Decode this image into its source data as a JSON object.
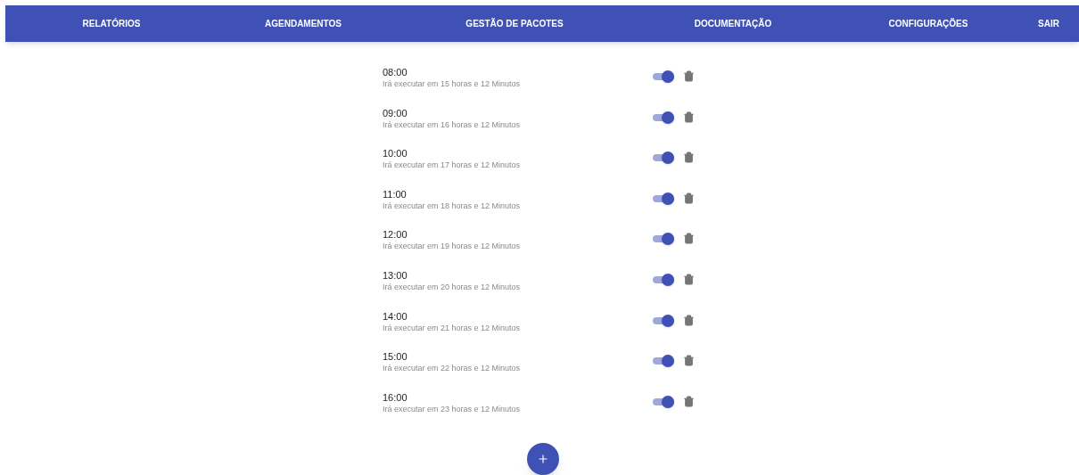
{
  "nav": [
    {
      "label": "RELATÓRIOS"
    },
    {
      "label": "AGENDAMENTOS"
    },
    {
      "label": "GESTÃO DE PACOTES"
    },
    {
      "label": "DOCUMENTAÇÃO"
    },
    {
      "label": "CONFIGURAÇÕES"
    },
    {
      "label": "SAIR"
    }
  ],
  "schedules": [
    {
      "time": "08:00",
      "subtitle": "Irá executar em 15 horas e 12 Minutos",
      "on": true
    },
    {
      "time": "09:00",
      "subtitle": "Irá executar em 16 horas e 12 Minutos",
      "on": true
    },
    {
      "time": "10:00",
      "subtitle": "Irá executar em 17 horas e 12 Minutos",
      "on": true
    },
    {
      "time": "11:00",
      "subtitle": "Irá executar em 18 horas e 12 Minutos",
      "on": true
    },
    {
      "time": "12:00",
      "subtitle": "Irá executar em 19 horas e 12 Minutos",
      "on": true
    },
    {
      "time": "13:00",
      "subtitle": "Irá executar em 20 horas e 12 Minutos",
      "on": true
    },
    {
      "time": "14:00",
      "subtitle": "Irá executar em 21 horas e 12 Minutos",
      "on": true
    },
    {
      "time": "15:00",
      "subtitle": "Irá executar em 22 horas e 12 Minutos",
      "on": true
    },
    {
      "time": "16:00",
      "subtitle": "Irá executar em 23 horas e 12 Minutos",
      "on": true
    }
  ]
}
